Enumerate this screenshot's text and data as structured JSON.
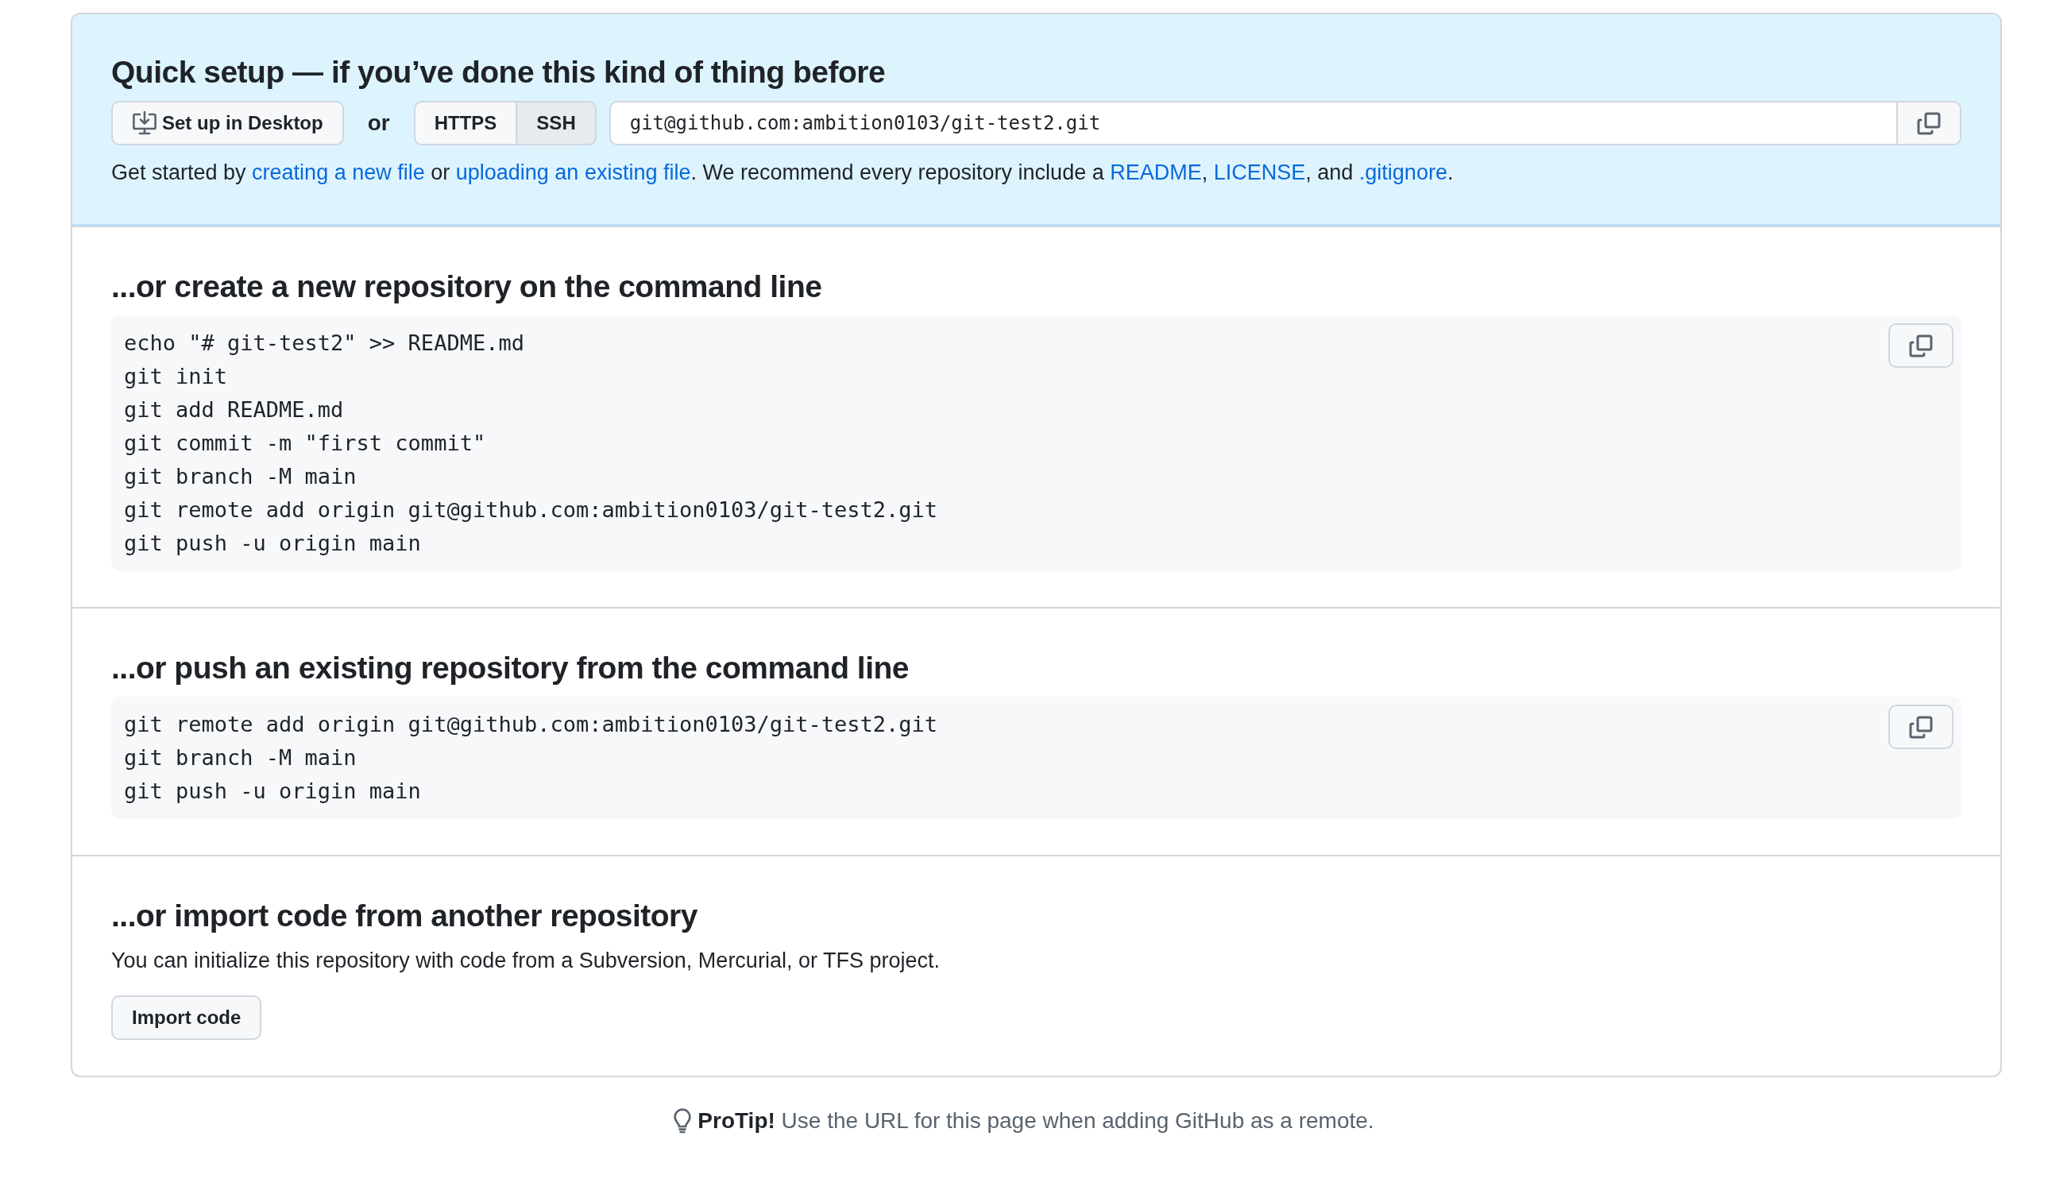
{
  "quick_setup": {
    "title": "Quick setup — if you’ve done this kind of thing before",
    "desktop_button": "Set up in Desktop",
    "or": "or",
    "protocols": [
      {
        "label": "HTTPS",
        "selected": false
      },
      {
        "label": "SSH",
        "selected": true
      }
    ],
    "url": "git@github.com:ambition0103/git-test2.git",
    "intro": [
      {
        "kind": "text",
        "text": "Get started by "
      },
      {
        "kind": "link",
        "text": "creating a new file"
      },
      {
        "kind": "text",
        "text": " or "
      },
      {
        "kind": "link",
        "text": "uploading an existing file"
      },
      {
        "kind": "text",
        "text": ". We recommend every repository include a "
      },
      {
        "kind": "link",
        "text": "README"
      },
      {
        "kind": "text",
        "text": ", "
      },
      {
        "kind": "link",
        "text": "LICENSE"
      },
      {
        "kind": "text",
        "text": ", and "
      },
      {
        "kind": "link",
        "text": ".gitignore"
      },
      {
        "kind": "text",
        "text": "."
      }
    ]
  },
  "sections": [
    {
      "kind": "code",
      "title": "...or create a new repository on the command line",
      "lines": [
        "echo \"# git-test2\" >> README.md",
        "git init",
        "git add README.md",
        "git commit -m \"first commit\"",
        "git branch -M main",
        "git remote add origin git@github.com:ambition0103/git-test2.git",
        "git push -u origin main"
      ]
    },
    {
      "kind": "code",
      "title": "...or push an existing repository from the command line",
      "lines": [
        "git remote add origin git@github.com:ambition0103/git-test2.git",
        "git branch -M main",
        "git push -u origin main"
      ]
    },
    {
      "kind": "import",
      "title": "...or import code from another repository",
      "text": "You can initialize this repository with code from a Subversion, Mercurial, or TFS project.",
      "button": "Import code"
    }
  ],
  "protip": {
    "label": "ProTip!",
    "text": "Use the URL for this page when adding GitHub as a remote."
  }
}
